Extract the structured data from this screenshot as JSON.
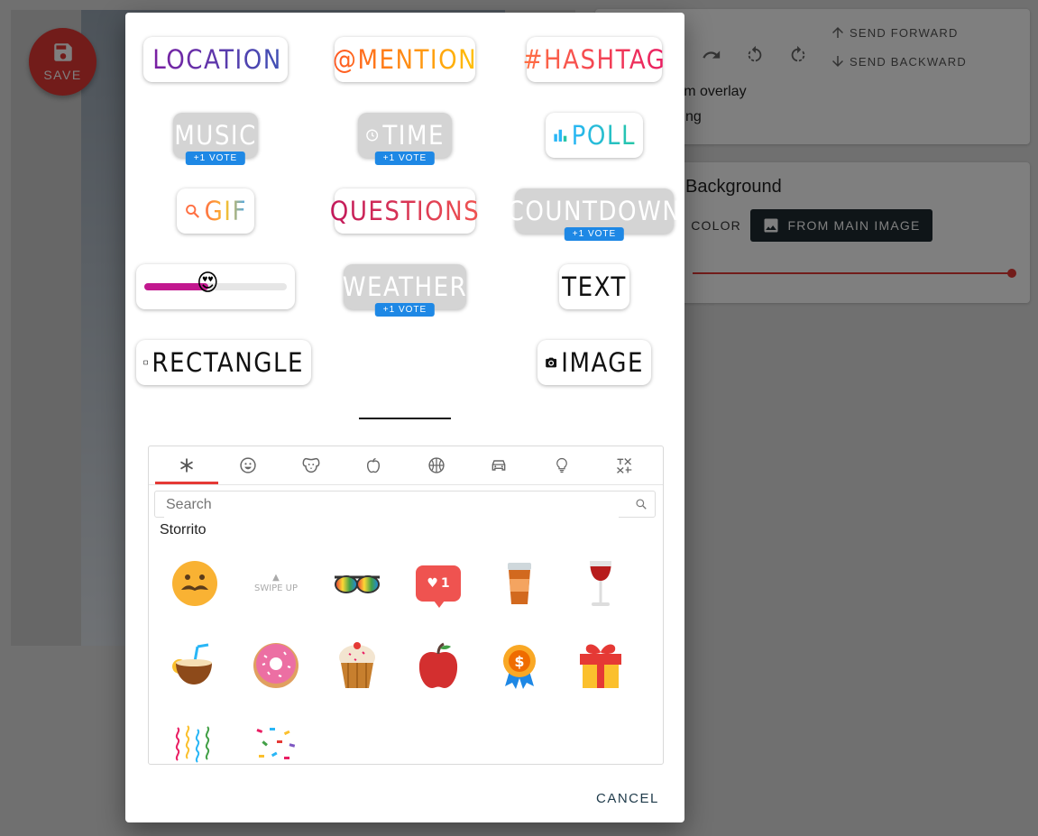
{
  "app": {
    "save_label": "SAVE",
    "send_forward": "SEND FORWARD",
    "send_backward": "SEND BACKWARD",
    "overlay_text": "ram overlay",
    "overlay_text2": "ng",
    "background_title": "Background",
    "color_button": "COLOR",
    "from_image_button": "FROM MAIN IMAGE"
  },
  "stickers": {
    "location": "LOCATION",
    "mention": "@MENTION",
    "hashtag": "#HASHTAG",
    "music": "MUSIC",
    "time": "TIME",
    "poll": "POLL",
    "gif": "GIF",
    "questions": "QUESTIONS",
    "countdown": "COUNTDOWN",
    "weather": "WEATHER",
    "text": "TEXT",
    "rectangle": "RECTANGLE",
    "image": "IMAGE",
    "vote_badge": "+1 VOTE"
  },
  "slider_level": 0.45,
  "picker": {
    "tabs": [
      "frequent-icon",
      "smiley-icon",
      "animal-icon",
      "food-icon",
      "sport-icon",
      "travel-icon",
      "object-icon",
      "symbol-icon"
    ],
    "active_tab": 0,
    "search_placeholder": "Search",
    "category_label": "Storrito",
    "stickers": [
      {
        "name": "mustache-face-sticker",
        "label": ""
      },
      {
        "name": "swipe-up-sticker",
        "label": "SWIPE UP"
      },
      {
        "name": "rainbow-glasses-sticker",
        "label": ""
      },
      {
        "name": "like-notification-sticker",
        "label": "1"
      },
      {
        "name": "coffee-cup-sticker",
        "label": ""
      },
      {
        "name": "wine-glass-sticker",
        "label": ""
      },
      {
        "name": "coconut-drink-sticker",
        "label": ""
      },
      {
        "name": "donut-sticker",
        "label": ""
      },
      {
        "name": "cupcake-sticker",
        "label": ""
      },
      {
        "name": "apple-sticker",
        "label": ""
      },
      {
        "name": "medal-sticker",
        "label": ""
      },
      {
        "name": "gift-sticker",
        "label": ""
      },
      {
        "name": "streamers-sticker",
        "label": ""
      },
      {
        "name": "confetti-sticker",
        "label": ""
      }
    ]
  },
  "cancel_label": "CANCEL"
}
